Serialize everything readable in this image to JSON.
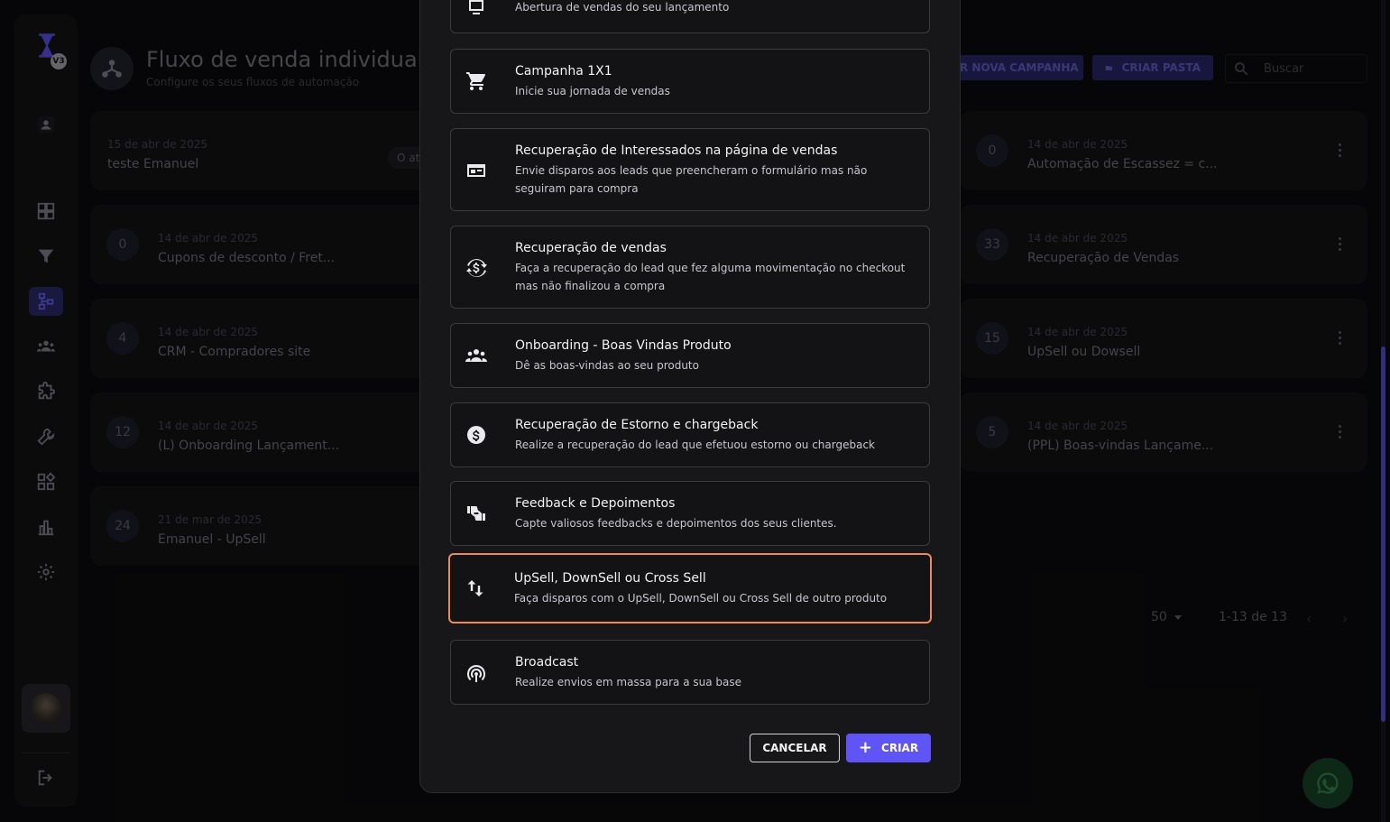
{
  "header": {
    "title": "Fluxo de venda individual",
    "subtitle": "Configure os seus fluxos de automação",
    "new_campaign_label": "R NOVA CAMPANHA",
    "create_folder_label": "CRIAR PASTA",
    "search_placeholder": "Buscar"
  },
  "sidebar": {
    "logo_badge": "V3"
  },
  "cards_left": [
    {
      "count": "",
      "date": "15 de abr de 2025",
      "name": "teste Emanuel",
      "tag": "O at"
    },
    {
      "count": "0",
      "date": "14 de abr de 2025",
      "name": "Cupons de desconto / Fret..."
    },
    {
      "count": "4",
      "date": "14 de abr de 2025",
      "name": "CRM - Compradores site"
    },
    {
      "count": "12",
      "date": "14 de abr de 2025",
      "name": "(L) Onboarding Lançament..."
    },
    {
      "count": "24",
      "date": "21 de mar de 2025",
      "name": "Emanuel - UpSell"
    }
  ],
  "cards_right": [
    {
      "count": "0",
      "date": "14 de abr de 2025",
      "name": "Automação de Escassez = c..."
    },
    {
      "count": "33",
      "date": "14 de abr de 2025",
      "name": "Recuperação de Vendas"
    },
    {
      "count": "15",
      "date": "14 de abr de 2025",
      "name": "UpSell ou Dowsell"
    },
    {
      "count": "5",
      "date": "14 de abr de 2025",
      "name": "(PPL) Boas-vindas Lançame..."
    }
  ],
  "pagination": {
    "per_page": "50",
    "range": "1-13 de 13"
  },
  "modal": {
    "options": [
      {
        "icon": "launch-icon",
        "title": "",
        "desc": "Abertura de vendas do seu lançamento"
      },
      {
        "icon": "cart-icon",
        "title": "Campanha 1X1",
        "desc": "Inicie sua jornada de vendas"
      },
      {
        "icon": "form-icon",
        "title": "Recuperação de Interessados na página de vendas",
        "desc": "Envie disparos aos leads que preencheram o formulário mas não seguiram para compra"
      },
      {
        "icon": "currency-sync-icon",
        "title": "Recuperação de vendas",
        "desc": "Faça a recuperação do lead que fez alguma movimentação no checkout mas não finalizou a compra"
      },
      {
        "icon": "group-icon",
        "title": "Onboarding - Boas Vindas Produto",
        "desc": "Dê as boas-vindas ao seu produto"
      },
      {
        "icon": "dollar-circle-icon",
        "title": "Recuperação de Estorno e chargeback",
        "desc": "Realize a recuperação do lead que efetuou estorno ou chargeback"
      },
      {
        "icon": "thumbs-icon",
        "title": "Feedback e Depoimentos",
        "desc": "Capte valiosos feedbacks e depoimentos dos seus clientes."
      },
      {
        "icon": "swap-vert-icon",
        "title": "UpSell, DownSell ou Cross Sell",
        "desc": "Faça disparos com o UpSell, DownSell ou Cross Sell de outro produto"
      },
      {
        "icon": "broadcast-icon",
        "title": "Broadcast",
        "desc": "Realize envios em massa para a sua base"
      }
    ],
    "cancel_label": "CANCELAR",
    "create_label": "CRIAR"
  },
  "colors": {
    "accent": "#5f54f6",
    "selected_border": "#f08a52"
  }
}
